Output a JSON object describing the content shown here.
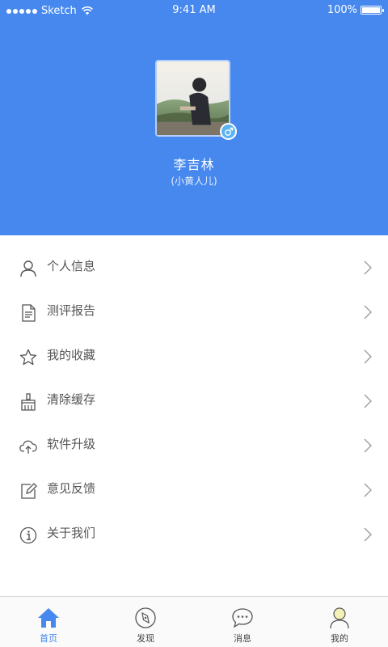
{
  "status_bar": {
    "carrier": "Sketch",
    "time": "9:41 AM",
    "battery": "100%"
  },
  "profile": {
    "name": "李吉林",
    "nickname": "(小黄人儿)",
    "gender_icon": "male-icon"
  },
  "menu": {
    "items": [
      {
        "label": "个人信息",
        "icon": "user-icon"
      },
      {
        "label": "测评报告",
        "icon": "document-icon"
      },
      {
        "label": "我的收藏",
        "icon": "star-icon"
      },
      {
        "label": "清除缓存",
        "icon": "broom-icon"
      },
      {
        "label": "软件升级",
        "icon": "cloud-upload-icon"
      },
      {
        "label": "意见反馈",
        "icon": "edit-icon"
      },
      {
        "label": "关于我们",
        "icon": "info-icon"
      }
    ]
  },
  "tabbar": {
    "tabs": [
      {
        "label": "首页",
        "icon": "home-icon",
        "active": true
      },
      {
        "label": "发现",
        "icon": "compass-icon",
        "active": false
      },
      {
        "label": "消息",
        "icon": "chat-bubble-icon",
        "active": false
      },
      {
        "label": "我的",
        "icon": "profile-icon",
        "active": false
      }
    ]
  },
  "colors": {
    "header": "#4688ee",
    "accent": "#4688ee",
    "badge": "#5bb3f0"
  }
}
